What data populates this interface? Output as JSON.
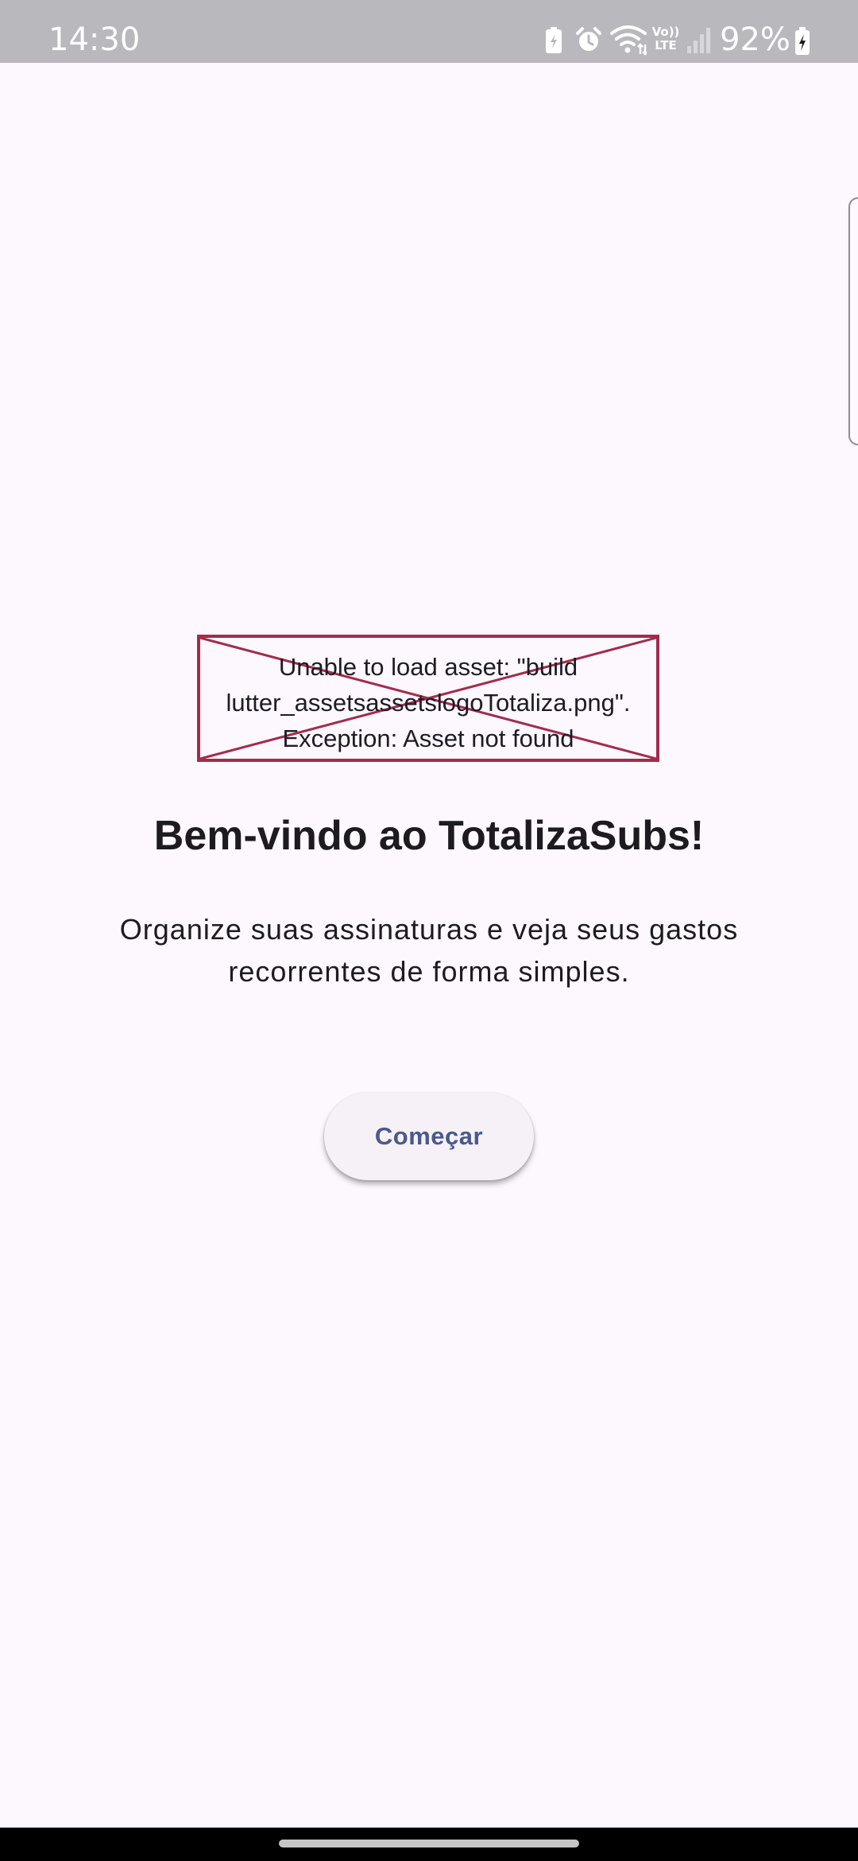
{
  "status_bar": {
    "time": "14:30",
    "battery": "92%",
    "icons": [
      "battery-saver-icon",
      "alarm-icon",
      "wifi-icon",
      "volte-icon",
      "signal-icon",
      "battery-charging-icon"
    ],
    "volte_label": "Vo))\nLTE"
  },
  "asset_error": {
    "message": "Unable to load asset: \"build\nlutter_assetsassetslogoTotaliza.png\".\nException: Asset not found",
    "border_color": "#a32b4c"
  },
  "welcome": {
    "title": "Bem-vindo ao TotalizaSubs!",
    "subtitle": "Organize suas assinaturas e veja seus gastos recorrentes de forma simples.",
    "start_button_label": "Começar"
  },
  "colors": {
    "background": "#fcf8fe",
    "status_bar": "#b9b8bd",
    "button_text": "#4a5989",
    "button_bg": "#f5f1f7"
  }
}
